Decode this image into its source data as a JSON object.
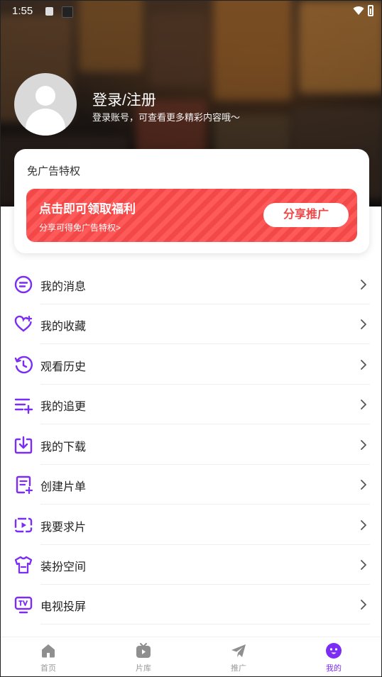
{
  "status_bar": {
    "time": "1:55"
  },
  "profile": {
    "title": "登录/注册",
    "subtitle": "登录账号，可查看更多精彩内容哦～"
  },
  "promo": {
    "card_title": "免广告特权",
    "banner_title": "点击即可领取福利",
    "banner_subtitle": "分享可得免广告特权>",
    "share_button": "分享推广"
  },
  "menu": {
    "items": [
      {
        "label": "我的消息",
        "icon": "message-icon"
      },
      {
        "label": "我的收藏",
        "icon": "favorite-heart-icon"
      },
      {
        "label": "观看历史",
        "icon": "history-icon"
      },
      {
        "label": "我的追更",
        "icon": "follow-updates-icon"
      },
      {
        "label": "我的下载",
        "icon": "download-icon"
      },
      {
        "label": "创建片单",
        "icon": "create-playlist-icon"
      },
      {
        "label": "我要求片",
        "icon": "request-video-icon"
      },
      {
        "label": "装扮空间",
        "icon": "dress-up-icon"
      },
      {
        "label": "电视投屏",
        "icon": "tv-cast-icon"
      }
    ]
  },
  "bottom_nav": {
    "tabs": [
      {
        "label": "首页",
        "icon": "home-icon",
        "active": false
      },
      {
        "label": "片库",
        "icon": "library-icon",
        "active": false
      },
      {
        "label": "推广",
        "icon": "paper-plane-icon",
        "active": false
      },
      {
        "label": "我的",
        "icon": "profile-face-icon",
        "active": true
      }
    ]
  },
  "colors": {
    "accent": "#7b2cf5",
    "banner_red": "#f24848",
    "inactive_nav": "#9a9a9a"
  }
}
